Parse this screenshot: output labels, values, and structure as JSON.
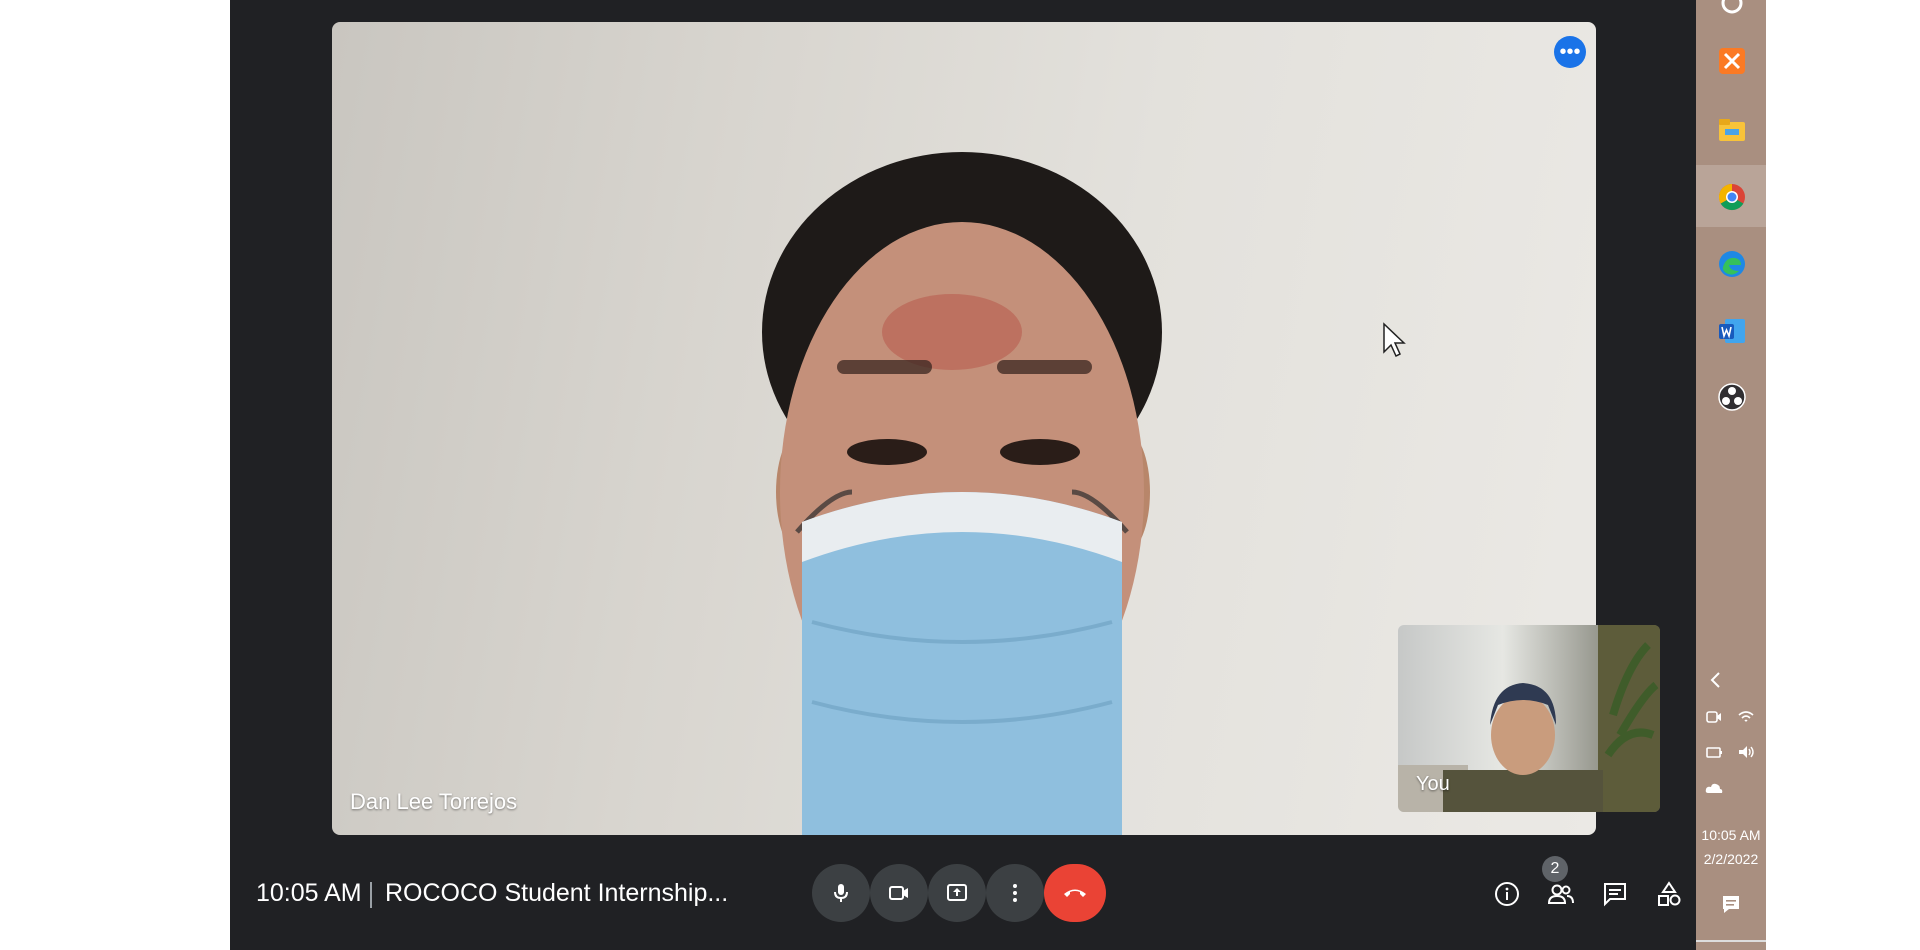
{
  "meeting": {
    "main_participant": "Dan Lee Torrejos",
    "self_label": "You"
  },
  "bottom_bar": {
    "time": "10:05 AM",
    "title": "ROCOCO Student Internship...",
    "participants_count": "2"
  },
  "controls": {
    "mic": "mic-icon",
    "camera": "camera-icon",
    "present": "present-icon",
    "more": "more-options-icon",
    "end": "end-call-icon",
    "info": "info-icon",
    "people": "people-icon",
    "chat": "chat-icon",
    "activities": "activities-icon"
  },
  "taskbar": {
    "apps": [
      "xampp-icon",
      "file-explorer-icon",
      "chrome-icon",
      "edge-icon",
      "word-icon",
      "obs-icon"
    ],
    "time": "10:05 AM",
    "date": "2/2/2022"
  },
  "colors": {
    "meet_bg": "#202124",
    "button_bg": "#3c4043",
    "end_call": "#ea4335",
    "accent": "#1a73e8",
    "taskbar": "#a98f80"
  }
}
